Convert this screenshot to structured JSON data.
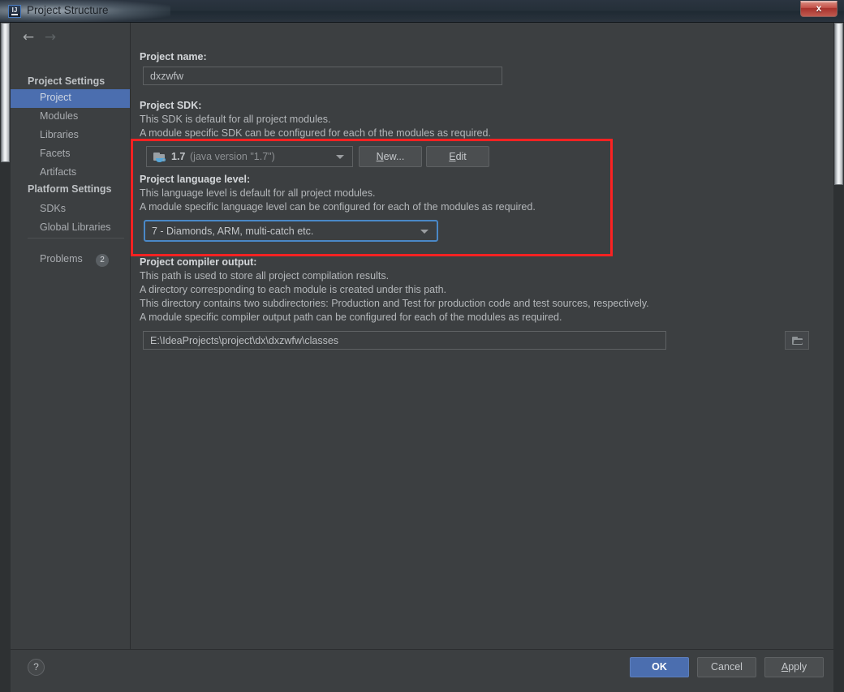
{
  "window": {
    "title": "Project Structure",
    "app_icon": "intellij-idea-icon",
    "close_label": "✕"
  },
  "nav": {
    "back_icon": "←",
    "forward_icon": "→"
  },
  "sidebar": {
    "groups": [
      {
        "title": "Project Settings",
        "items": [
          {
            "label": "Project",
            "selected": true
          },
          {
            "label": "Modules",
            "selected": false
          },
          {
            "label": "Libraries",
            "selected": false
          },
          {
            "label": "Facets",
            "selected": false
          },
          {
            "label": "Artifacts",
            "selected": false
          }
        ]
      },
      {
        "title": "Platform Settings",
        "items": [
          {
            "label": "SDKs",
            "selected": false
          },
          {
            "label": "Global Libraries",
            "selected": false
          }
        ]
      }
    ],
    "problems": {
      "label": "Problems",
      "count": "2"
    }
  },
  "main": {
    "project_name": {
      "label": "Project name:",
      "value": "dxzwfw"
    },
    "project_sdk": {
      "label": "Project SDK:",
      "description_line1": "This SDK is default for all project modules.",
      "description_line2": "A module specific SDK can be configured for each of the modules as required.",
      "selected_version": "1.7",
      "selected_detail": "(java version \"1.7\")",
      "icon": "jdk-folder-icon",
      "new_button": "New...",
      "new_button_mnemonic": "N",
      "edit_button": "Edit",
      "edit_button_mnemonic": "E"
    },
    "language_level": {
      "label": "Project language level:",
      "description_line1": "This language level is default for all project modules.",
      "description_line2": "A module specific language level can be configured for each of the modules as required.",
      "selected": "7 - Diamonds, ARM, multi-catch etc."
    },
    "compiler_output": {
      "label": "Project compiler output:",
      "description_line1": "This path is used to store all project compilation results.",
      "description_line2": "A directory corresponding to each module is created under this path.",
      "description_line3": "This directory contains two subdirectories: Production and Test for production code and test sources, respectively.",
      "description_line4": "A module specific compiler output path can be configured for each of the modules as required.",
      "path": "E:\\IdeaProjects\\project\\dx\\dxzwfw\\classes",
      "browse_icon": "folder-browse-icon"
    }
  },
  "footer": {
    "help_label": "?",
    "ok_label": "OK",
    "cancel_label": "Cancel",
    "apply_label": "Apply",
    "apply_mnemonic": "A"
  },
  "annotation": {
    "color": "#fc2222",
    "target": "project-sdk-and-language-level-region"
  },
  "colors": {
    "window_bg": "#3c3f41",
    "selection": "#4b6eaf",
    "accent_focus": "#4a88c7",
    "annotation_red": "#fc2222",
    "titlebar": "#253039"
  }
}
